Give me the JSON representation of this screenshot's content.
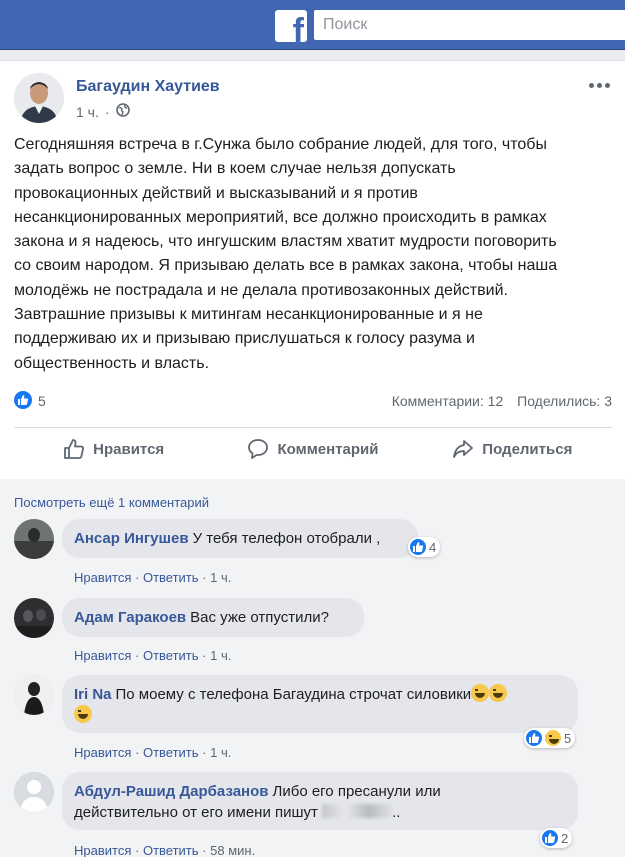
{
  "header": {
    "logo_letter": "f",
    "search_placeholder": "Поиск"
  },
  "post": {
    "author": "Багаудин Хаутиев",
    "time": "1 ч.",
    "privacy_icon": "globe-icon",
    "text": "Сегодняшняя встреча в г.Сунжа было собрание людей, для того, чтобы\nзадать вопрос о земле. Ни в коем случае нельзя допускать\nпровокационных действий и высказываний и я против\nнесанкционированных мероприятий, все должно происходить в рамках\nзакона и я надеюсь, что ингушским властям хватит мудрости поговорить\nсо своим народом. Я призываю делать все в рамках закона, чтобы наша\nмолодёжь не пострадала и не делала противозаконных действий.\nЗавтрашние призывы к митингам несанкционированные и я не\nподдерживаю их и призываю прислушаться к голосу разума и\nобщественность и власть.",
    "likes": "5",
    "comments_count": "Комментарии: 12",
    "shares_count": "Поделились: 3"
  },
  "actions": {
    "like": "Нравится",
    "comment": "Комментарий",
    "share": "Поделиться"
  },
  "comments_section": {
    "view_more": "Посмотреть ещё 1 комментарий",
    "like_label": "Нравится",
    "reply_label": "Ответить",
    "sep": "·",
    "items": [
      {
        "name": "Ансар Ингушев",
        "text": "У тебя телефон отобрали ,",
        "time": "1 ч.",
        "reactions": "4"
      },
      {
        "name": "Адам Гаракоев",
        "text": "Вас уже отпустили?",
        "time": "1 ч."
      },
      {
        "name": "Iri Na",
        "text_line1": "По моему с телефона Багаудина строчат силовики",
        "time": "1 ч.",
        "reactions": "5"
      },
      {
        "name": "Абдул-Рашид Дарбазанов",
        "text_line1": "Либо его пресанули или",
        "text_line2_start": "действительно от его имени пишут",
        "text_line2_end": "..",
        "time": "58 мин.",
        "reactions": "2"
      }
    ]
  },
  "colors": {
    "brand": "#4267b2",
    "link": "#385898",
    "like_blue": "#1877f2"
  }
}
